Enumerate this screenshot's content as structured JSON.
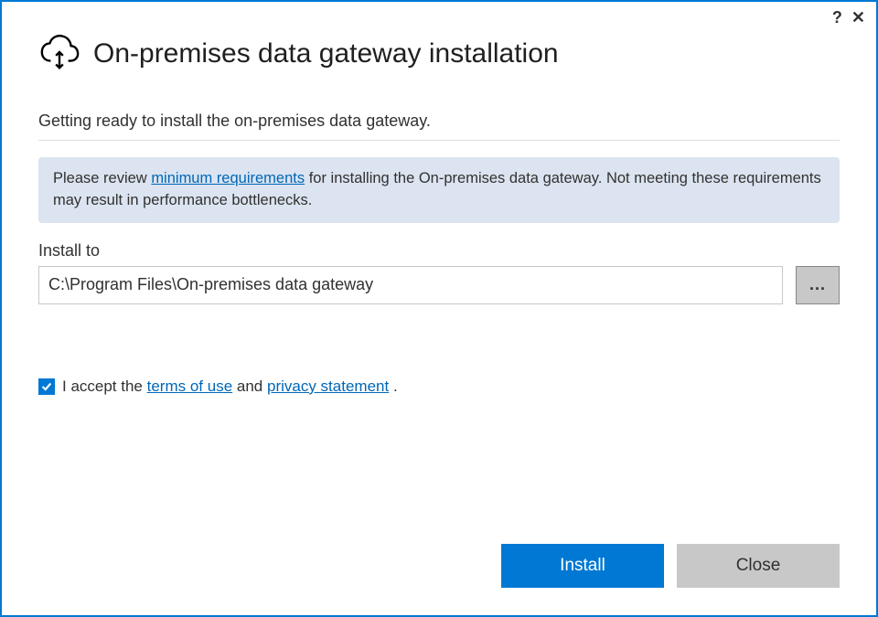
{
  "titlebar": {
    "help": "?",
    "close": "✕"
  },
  "header": {
    "title": "On-premises data gateway installation"
  },
  "subtitle": "Getting ready to install the on-premises data gateway.",
  "banner": {
    "before": "Please review ",
    "link": "minimum requirements",
    "after": " for installing the On-premises data gateway. Not meeting these requirements may result in performance bottlenecks."
  },
  "install_path": {
    "label": "Install to",
    "value": "C:\\Program Files\\On-premises data gateway",
    "browse": "..."
  },
  "accept": {
    "checked": true,
    "before": "I accept the ",
    "terms_link": "terms of use",
    "middle": " and ",
    "privacy_link": "privacy statement",
    "after": " ."
  },
  "buttons": {
    "install": "Install",
    "close": "Close"
  }
}
